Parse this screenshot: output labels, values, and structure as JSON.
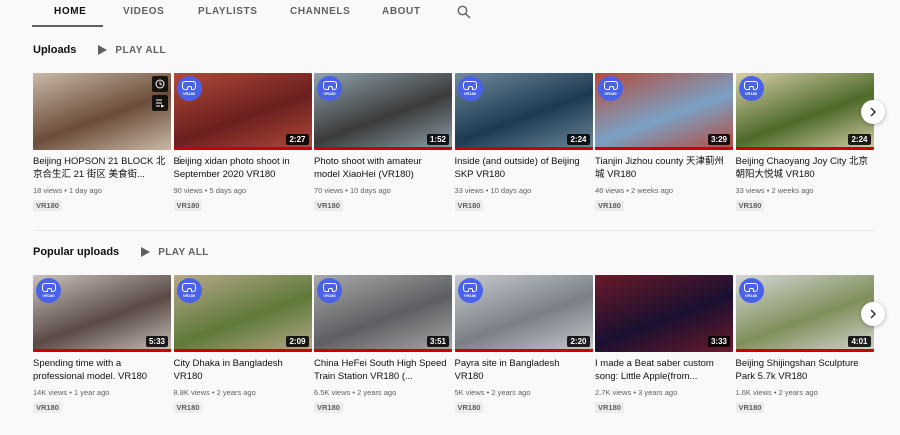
{
  "nav": {
    "tabs": [
      "HOME",
      "VIDEOS",
      "PLAYLISTS",
      "CHANNELS",
      "ABOUT"
    ],
    "active": "HOME"
  },
  "sections": [
    {
      "title": "Uploads",
      "play_all": "PLAY ALL",
      "videos": [
        {
          "title": "Beijing HOPSON 21 BLOCK 北京合生汇 21 街区 美食街...",
          "views": "18 views",
          "age": "1 day ago",
          "badge": "VR180",
          "duration": "",
          "progress": 0,
          "vr": false,
          "thumb_colors": [
            "#6b4c3a",
            "#c9b9a6"
          ]
        },
        {
          "title": "Beijing xidan photo shoot in September 2020 VR180",
          "views": "90 views",
          "age": "5 days ago",
          "badge": "VR180",
          "duration": "2:27",
          "progress": 1.0,
          "vr": true,
          "thumb_colors": [
            "#6c1f1f",
            "#b04b3a"
          ]
        },
        {
          "title": "Photo shoot with amateur model XiaoHei (VR180)",
          "views": "70 views",
          "age": "10 days ago",
          "badge": "VR180",
          "duration": "1:52",
          "progress": 1.0,
          "vr": true,
          "thumb_colors": [
            "#3b3b3b",
            "#8fa2ad"
          ]
        },
        {
          "title": "Inside (and outside) of Beijing SKP VR180",
          "views": "33 views",
          "age": "10 days ago",
          "badge": "VR180",
          "duration": "2:24",
          "progress": 1.0,
          "vr": true,
          "thumb_colors": [
            "#1e3a52",
            "#6f8a9c"
          ]
        },
        {
          "title": "Tianjin Jizhou county 天津蓟州城 VR180",
          "views": "46 views",
          "age": "2 weeks ago",
          "badge": "VR180",
          "duration": "3:29",
          "progress": 1.0,
          "vr": true,
          "thumb_colors": [
            "#7aa0c4",
            "#b54b3a"
          ]
        },
        {
          "title": "Beijing Chaoyang Joy City 北京朝阳大悦城 VR180",
          "views": "33 views",
          "age": "2 weeks ago",
          "badge": "VR180",
          "duration": "2:24",
          "progress": 1.0,
          "vr": true,
          "thumb_colors": [
            "#4d6a2a",
            "#d7cfa8"
          ]
        }
      ]
    },
    {
      "title": "Popular uploads",
      "play_all": "PLAY ALL",
      "videos": [
        {
          "title": "Spending time with a professional model. VR180",
          "views": "14K views",
          "age": "1 year ago",
          "badge": "VR180",
          "duration": "5:33",
          "progress": 1.0,
          "vr": true,
          "thumb_colors": [
            "#5a4a45",
            "#c9c2bc"
          ]
        },
        {
          "title": "City Dhaka in Bangladesh VR180",
          "views": "8.8K views",
          "age": "2 years ago",
          "badge": "VR180",
          "duration": "2:09",
          "progress": 1.0,
          "vr": true,
          "thumb_colors": [
            "#5f7a3a",
            "#b7a98a"
          ]
        },
        {
          "title": "China HeFei South High Speed Train Station VR180 (...",
          "views": "6.5K views",
          "age": "2 years ago",
          "badge": "VR180",
          "duration": "3:51",
          "progress": 1.0,
          "vr": true,
          "thumb_colors": [
            "#5d5f62",
            "#a8a9aa"
          ]
        },
        {
          "title": "Payra site in Bangladesh VR180",
          "views": "5K views",
          "age": "2 years ago",
          "badge": "VR180",
          "duration": "2:20",
          "progress": 1.0,
          "vr": true,
          "thumb_colors": [
            "#7a7f86",
            "#c8ccd0"
          ]
        },
        {
          "title": "I made a Beat saber custom song: Little Apple(from...",
          "views": "2.7K views",
          "age": "3 years ago",
          "badge": "VR180",
          "duration": "3:33",
          "progress": 0,
          "vr": false,
          "thumb_colors": [
            "#1a1030",
            "#6a1a2a"
          ]
        },
        {
          "title": "Beijing Shijingshan Sculpture Park 5.7k VR180",
          "views": "1.6K views",
          "age": "2 years ago",
          "badge": "VR180",
          "duration": "4:01",
          "progress": 1.0,
          "vr": true,
          "thumb_colors": [
            "#7f8f5a",
            "#d6d8d6"
          ]
        }
      ]
    }
  ],
  "accent_color": "#cc0000"
}
